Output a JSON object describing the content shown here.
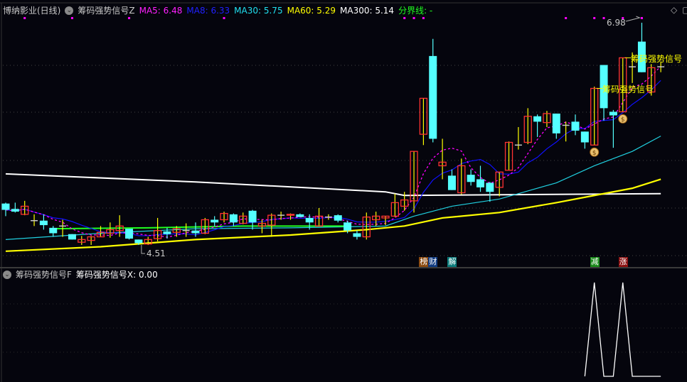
{
  "header": {
    "stock": "博纳影业(日线)",
    "indicator": "筹码强势信号Z",
    "ma5": "MA5: 6.48",
    "ma8": "MA8: 6.33",
    "ma30": "MA30: 5.75",
    "ma60": "MA60: 5.29",
    "ma300": "MA300: 5.14",
    "divider": "分界线: -"
  },
  "lower_header": {
    "indicator": "筹码强势信号F",
    "value": "筹码强势信号X: 0.00"
  },
  "colors": {
    "up": "#ff3232",
    "down": "#54ffff",
    "ma5": "#ff00ff",
    "ma8": "#1010ff",
    "ma30": "#20d0e0",
    "ma60": "#ffff00",
    "ma300": "#ffffff"
  },
  "annotations": {
    "high": "6.98",
    "low": "4.51",
    "signal1": "筹码强势信号",
    "signal2": "筹码强势信号"
  },
  "tags": [
    {
      "text": "榜",
      "bg": "#8b4a10",
      "bar": 44
    },
    {
      "text": "财",
      "bg": "#103a80",
      "bar": 44
    },
    {
      "text": "解",
      "bg": "#0a7a7a",
      "bar": 47
    },
    {
      "text": "减",
      "bg": "#1a8a1a",
      "bar": 62
    },
    {
      "text": "涨",
      "bg": "#8a1010",
      "bar": 65
    }
  ],
  "icons": {
    "collapse": "chevron-down-icon",
    "diamond": "diamond-icon",
    "square": "square-icon",
    "money": "money-bag-icon"
  },
  "chart_data": {
    "type": "candlestick",
    "ylim": [
      4.35,
      7.05
    ],
    "candles": [
      [
        4.97,
        4.98,
        4.83,
        4.9
      ],
      [
        4.91,
        4.98,
        4.87,
        4.88
      ],
      [
        4.85,
        5.0,
        4.84,
        4.94
      ],
      [
        4.78,
        4.85,
        4.72,
        4.78
      ],
      [
        4.78,
        4.85,
        4.68,
        4.73
      ],
      [
        4.7,
        4.72,
        4.6,
        4.64
      ],
      [
        4.72,
        4.79,
        4.6,
        4.72
      ],
      [
        4.63,
        4.63,
        4.57,
        4.57
      ],
      [
        4.54,
        4.61,
        4.51,
        4.57
      ],
      [
        4.56,
        4.61,
        4.51,
        4.6
      ],
      [
        4.6,
        4.72,
        4.6,
        4.65
      ],
      [
        4.64,
        4.76,
        4.59,
        4.68
      ],
      [
        4.67,
        4.84,
        4.6,
        4.72
      ],
      [
        4.69,
        4.69,
        4.57,
        4.58
      ],
      [
        4.57,
        4.57,
        4.51,
        4.53
      ],
      [
        4.52,
        4.6,
        4.51,
        4.57
      ],
      [
        4.58,
        4.81,
        4.55,
        4.67
      ],
      [
        4.66,
        4.7,
        4.58,
        4.63
      ],
      [
        4.65,
        4.72,
        4.6,
        4.69
      ],
      [
        4.67,
        4.75,
        4.6,
        4.67
      ],
      [
        4.67,
        4.76,
        4.6,
        4.64
      ],
      [
        4.64,
        4.81,
        4.63,
        4.79
      ],
      [
        4.79,
        4.83,
        4.72,
        4.76
      ],
      [
        4.79,
        4.88,
        4.76,
        4.86
      ],
      [
        4.85,
        4.86,
        4.72,
        4.76
      ],
      [
        4.75,
        4.87,
        4.74,
        4.83
      ],
      [
        4.89,
        4.9,
        4.68,
        4.76
      ],
      [
        4.72,
        4.79,
        4.64,
        4.75
      ],
      [
        4.73,
        4.86,
        4.6,
        4.84
      ],
      [
        4.84,
        4.88,
        4.79,
        4.84
      ],
      [
        4.84,
        4.86,
        4.79,
        4.85
      ],
      [
        4.85,
        4.86,
        4.82,
        4.82
      ],
      [
        4.81,
        4.85,
        4.68,
        4.76
      ],
      [
        4.72,
        4.92,
        4.72,
        4.83
      ],
      [
        4.82,
        4.85,
        4.79,
        4.82
      ],
      [
        4.84,
        4.85,
        4.76,
        4.78
      ],
      [
        4.76,
        4.78,
        4.64,
        4.67
      ],
      [
        4.64,
        4.67,
        4.57,
        4.6
      ],
      [
        4.6,
        4.87,
        4.57,
        4.82
      ],
      [
        4.79,
        4.88,
        4.72,
        4.83
      ],
      [
        4.81,
        4.83,
        4.73,
        4.83
      ],
      [
        4.83,
        5.08,
        4.82,
        4.98
      ],
      [
        4.94,
        5.1,
        4.89,
        5.01
      ],
      [
        5.0,
        5.55,
        4.87,
        5.55
      ],
      [
        5.74,
        6.14,
        5.62,
        6.14
      ],
      [
        6.61,
        6.8,
        5.65,
        5.69
      ],
      [
        5.39,
        5.69,
        5.24,
        5.43
      ],
      [
        5.28,
        5.35,
        5.12,
        5.12
      ],
      [
        5.09,
        5.47,
        5.07,
        5.39
      ],
      [
        5.29,
        5.35,
        5.17,
        5.21
      ],
      [
        5.24,
        5.39,
        5.1,
        5.15
      ],
      [
        5.2,
        5.21,
        4.99,
        5.1
      ],
      [
        5.15,
        5.32,
        5.05,
        5.32
      ],
      [
        5.34,
        5.66,
        5.34,
        5.65
      ],
      [
        5.62,
        5.82,
        5.57,
        5.62
      ],
      [
        5.65,
        6.03,
        5.63,
        5.94
      ],
      [
        5.94,
        5.96,
        5.71,
        5.88
      ],
      [
        5.87,
        6.0,
        5.82,
        5.97
      ],
      [
        5.97,
        5.97,
        5.69,
        5.75
      ],
      [
        5.84,
        5.88,
        5.66,
        5.84
      ],
      [
        5.88,
        5.96,
        5.73,
        5.78
      ],
      [
        5.77,
        5.77,
        5.58,
        5.65
      ],
      [
        5.62,
        6.27,
        5.62,
        6.25
      ],
      [
        6.51,
        6.51,
        5.89,
        6.03
      ],
      [
        5.99,
        6.01,
        5.59,
        5.95
      ],
      [
        5.99,
        6.59,
        5.99,
        6.59
      ],
      [
        6.49,
        6.65,
        6.31,
        6.49
      ],
      [
        6.77,
        6.98,
        6.43,
        6.43
      ],
      [
        6.21,
        6.52,
        6.17,
        6.48
      ],
      [
        6.49,
        6.55,
        6.43,
        6.49
      ]
    ],
    "ma30": [
      [
        0,
        4.57
      ],
      [
        10,
        4.64
      ],
      [
        20,
        4.69
      ],
      [
        30,
        4.7
      ],
      [
        40,
        4.72
      ],
      [
        43,
        4.83
      ],
      [
        47,
        4.94
      ],
      [
        52,
        5.02
      ],
      [
        58,
        5.2
      ],
      [
        62,
        5.39
      ],
      [
        66,
        5.55
      ],
      [
        69,
        5.72
      ]
    ],
    "ma60": [
      [
        0,
        4.44
      ],
      [
        10,
        4.49
      ],
      [
        20,
        4.57
      ],
      [
        30,
        4.62
      ],
      [
        38,
        4.68
      ],
      [
        42,
        4.72
      ],
      [
        46,
        4.81
      ],
      [
        52,
        4.87
      ],
      [
        58,
        4.98
      ],
      [
        62,
        5.06
      ],
      [
        66,
        5.14
      ],
      [
        69,
        5.24
      ]
    ],
    "ma300": [
      [
        0,
        5.3
      ],
      [
        20,
        5.21
      ],
      [
        40,
        5.1
      ],
      [
        42,
        5.06
      ],
      [
        69,
        5.08
      ]
    ],
    "divider_line": [
      [
        5,
        4.69
      ],
      [
        15,
        4.7
      ],
      [
        25,
        4.72
      ],
      [
        36,
        4.72
      ]
    ],
    "signal_dots": [
      2,
      7,
      13,
      23,
      42,
      43,
      44,
      59,
      62,
      63,
      65,
      67
    ],
    "signal_bars": [
      62,
      65
    ],
    "high_bar": 67,
    "low_bar": 14,
    "lower": {
      "start": 61,
      "values": [
        0,
        1,
        0,
        0,
        1,
        0,
        0,
        0,
        0
      ],
      "ylim": [
        0,
        1
      ]
    }
  }
}
